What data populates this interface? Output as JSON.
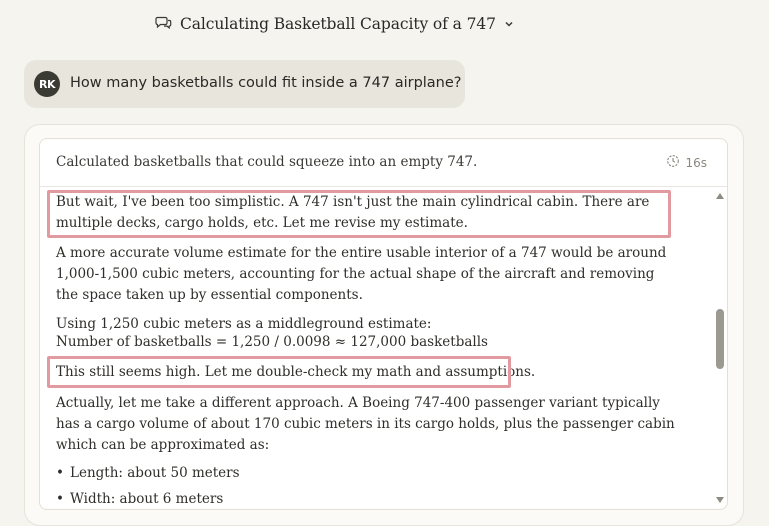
{
  "header": {
    "title": "Calculating Basketball Capacity of a 747"
  },
  "user_message": {
    "initials": "RK",
    "text": "How many basketballs could fit inside a 747 airplane?"
  },
  "thinking": {
    "summary": "Calculated basketballs that could squeeze into an empty 747.",
    "duration": "16s",
    "paragraphs": [
      "But wait, I've been too simplistic. A 747 isn't just the main cylindrical cabin. There are multiple decks, cargo holds, etc. Let me revise my estimate.",
      "A more accurate volume estimate for the entire usable interior of a 747 would be around 1,000-1,500 cubic meters, accounting for the actual shape of the aircraft and removing the space taken up by essential components.",
      "Using 1,250 cubic meters as a middleground estimate:",
      "Number of basketballs = 1,250 / 0.0098 ≈ 127,000 basketballs",
      "This still seems high. Let me double-check my math and assumptions.",
      "Actually, let me take a different approach. A Boeing 747-400 passenger variant typically has a cargo volume of about 170 cubic meters in its cargo holds, plus the passenger cabin which can be approximated as:"
    ],
    "bullets": [
      "Length: about 50 meters",
      "Width: about 6 meters"
    ]
  },
  "colors": {
    "highlight": "#e29aa1",
    "background": "#f5f4ef",
    "avatar": "#3b3a33"
  },
  "icons": [
    "chat-bubbles-icon",
    "chevron-down-icon",
    "clock-icon"
  ]
}
